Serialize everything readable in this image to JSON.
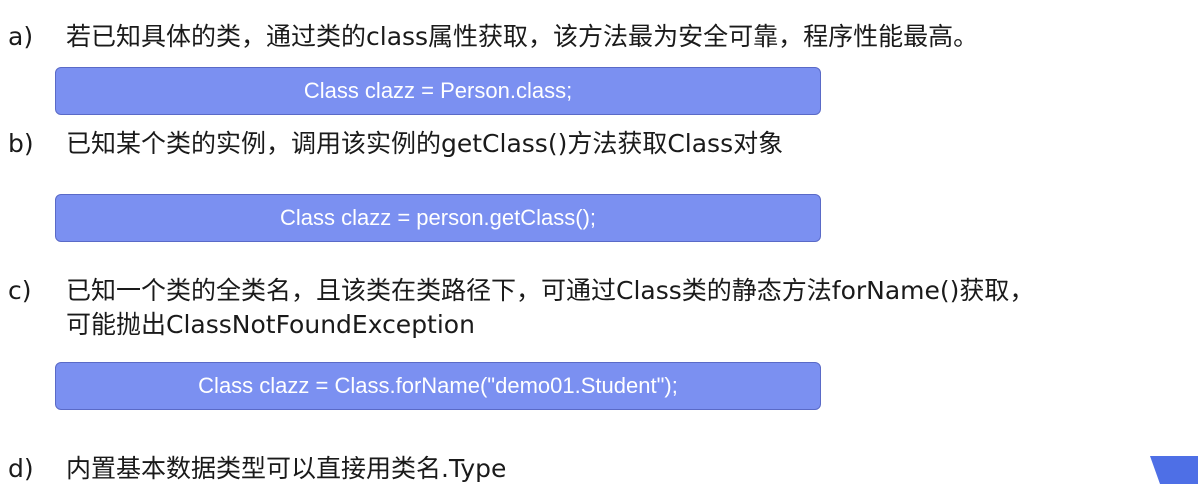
{
  "items": [
    {
      "marker": "a)",
      "text": "若已知具体的类，通过类的class属性获取，该方法最为安全可靠，程序性能最高。",
      "code": "Class clazz = Person.class;"
    },
    {
      "marker": "b)",
      "text": "已知某个类的实例，调用该实例的getClass()方法获取Class对象",
      "code": "Class clazz = person.getClass();"
    },
    {
      "marker": "c)",
      "text": "已知一个类的全类名，且该类在类路径下，可通过Class类的静态方法forName()获取，",
      "text_line2": "可能抛出ClassNotFoundException",
      "code": "Class clazz = Class.forName(\"demo01.Student\");"
    },
    {
      "marker": "d)",
      "text": "内置基本数据类型可以直接用类名.Type"
    }
  ],
  "colors": {
    "code_box_bg": "#7b90f1",
    "code_box_text": "#ffffff",
    "corner_shape": "#4e6fe6"
  }
}
